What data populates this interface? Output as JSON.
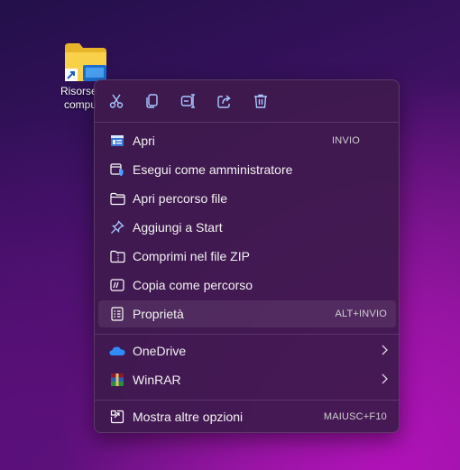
{
  "desktop": {
    "icon_label_line1": "Risorse",
    "icon_label_line2": "compu"
  },
  "menu": {
    "toolbar": [
      {
        "name": "cut-icon"
      },
      {
        "name": "copy-icon"
      },
      {
        "name": "rename-icon"
      },
      {
        "name": "share-icon"
      },
      {
        "name": "delete-icon"
      }
    ],
    "items": [
      {
        "label": "Apri",
        "shortcut": "INVIO",
        "icon": "open-icon"
      },
      {
        "label": "Esegui come amministratore",
        "shortcut": "",
        "icon": "run-as-admin-icon"
      },
      {
        "label": "Apri percorso file",
        "shortcut": "",
        "icon": "folder-icon"
      },
      {
        "label": "Aggiungi a Start",
        "shortcut": "",
        "icon": "pin-icon"
      },
      {
        "label": "Comprimi nel file ZIP",
        "shortcut": "",
        "icon": "zip-icon"
      },
      {
        "label": "Copia come percorso",
        "shortcut": "",
        "icon": "copy-path-icon"
      },
      {
        "label": "Proprietà",
        "shortcut": "ALT+INVIO",
        "icon": "properties-icon"
      },
      {
        "label": "OneDrive",
        "shortcut": "",
        "icon": "onedrive-icon"
      },
      {
        "label": "WinRAR",
        "shortcut": "",
        "icon": "winrar-icon"
      },
      {
        "label": "Mostra altre opzioni",
        "shortcut": "MAIUSC+F10",
        "icon": "more-options-icon"
      }
    ],
    "selected_item": "Proprietà"
  },
  "colors": {
    "menu_bg": "#3e1a4e",
    "accent_icon": "#a8c8ff",
    "onedrive_blue": "#2f8cff"
  }
}
